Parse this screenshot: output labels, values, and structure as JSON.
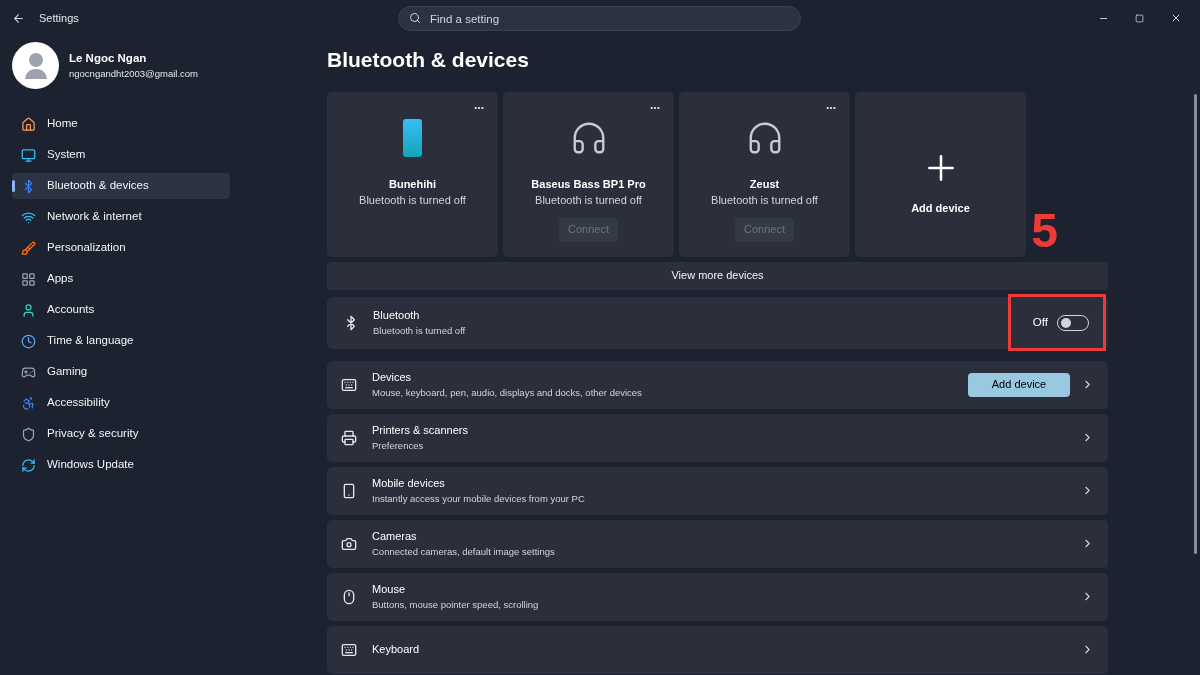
{
  "window": {
    "title": "Settings"
  },
  "search": {
    "placeholder": "Find a setting"
  },
  "user": {
    "name": "Le Ngoc Ngan",
    "email": "ngocngandht2003@gmail.com"
  },
  "sidebar": {
    "items": [
      {
        "label": "Home",
        "selected": false
      },
      {
        "label": "System",
        "selected": false
      },
      {
        "label": "Bluetooth & devices",
        "selected": true
      },
      {
        "label": "Network & internet",
        "selected": false
      },
      {
        "label": "Personalization",
        "selected": false
      },
      {
        "label": "Apps",
        "selected": false
      },
      {
        "label": "Accounts",
        "selected": false
      },
      {
        "label": "Time & language",
        "selected": false
      },
      {
        "label": "Gaming",
        "selected": false
      },
      {
        "label": "Accessibility",
        "selected": false
      },
      {
        "label": "Privacy & security",
        "selected": false
      },
      {
        "label": "Windows Update",
        "selected": false
      }
    ]
  },
  "page": {
    "title": "Bluetooth & devices"
  },
  "device_cards": [
    {
      "kind": "phone",
      "name": "Bunehihi",
      "status": "Bluetooth is turned off",
      "menu": "..."
    },
    {
      "kind": "headset",
      "name": "Baseus Bass BP1 Pro",
      "status": "Bluetooth is turned off",
      "menu": "...",
      "connect": {
        "label": "Connect",
        "disabled": true
      }
    },
    {
      "kind": "headset",
      "name": "Zeust",
      "status": "Bluetooth is turned off",
      "menu": "...",
      "connect": {
        "label": "Connect",
        "disabled": true
      }
    },
    {
      "kind": "add",
      "name": "Add device"
    }
  ],
  "view_more": "View more devices",
  "bluetooth": {
    "title": "Bluetooth",
    "subtitle": "Bluetooth is turned off",
    "state_label": "Off",
    "on": false,
    "highlighted": true
  },
  "annotation": {
    "step": "5"
  },
  "rows": [
    {
      "title": "Devices",
      "subtitle": "Mouse, keyboard, pen, audio, displays and docks, other devices",
      "button": "Add device"
    },
    {
      "title": "Printers & scanners",
      "subtitle": "Preferences"
    },
    {
      "title": "Mobile devices",
      "subtitle": "Instantly access your mobile devices from your PC"
    },
    {
      "title": "Cameras",
      "subtitle": "Connected cameras, default image settings"
    },
    {
      "title": "Mouse",
      "subtitle": "Buttons, mouse pointer speed, scrolling"
    },
    {
      "title": "Keyboard"
    }
  ]
}
